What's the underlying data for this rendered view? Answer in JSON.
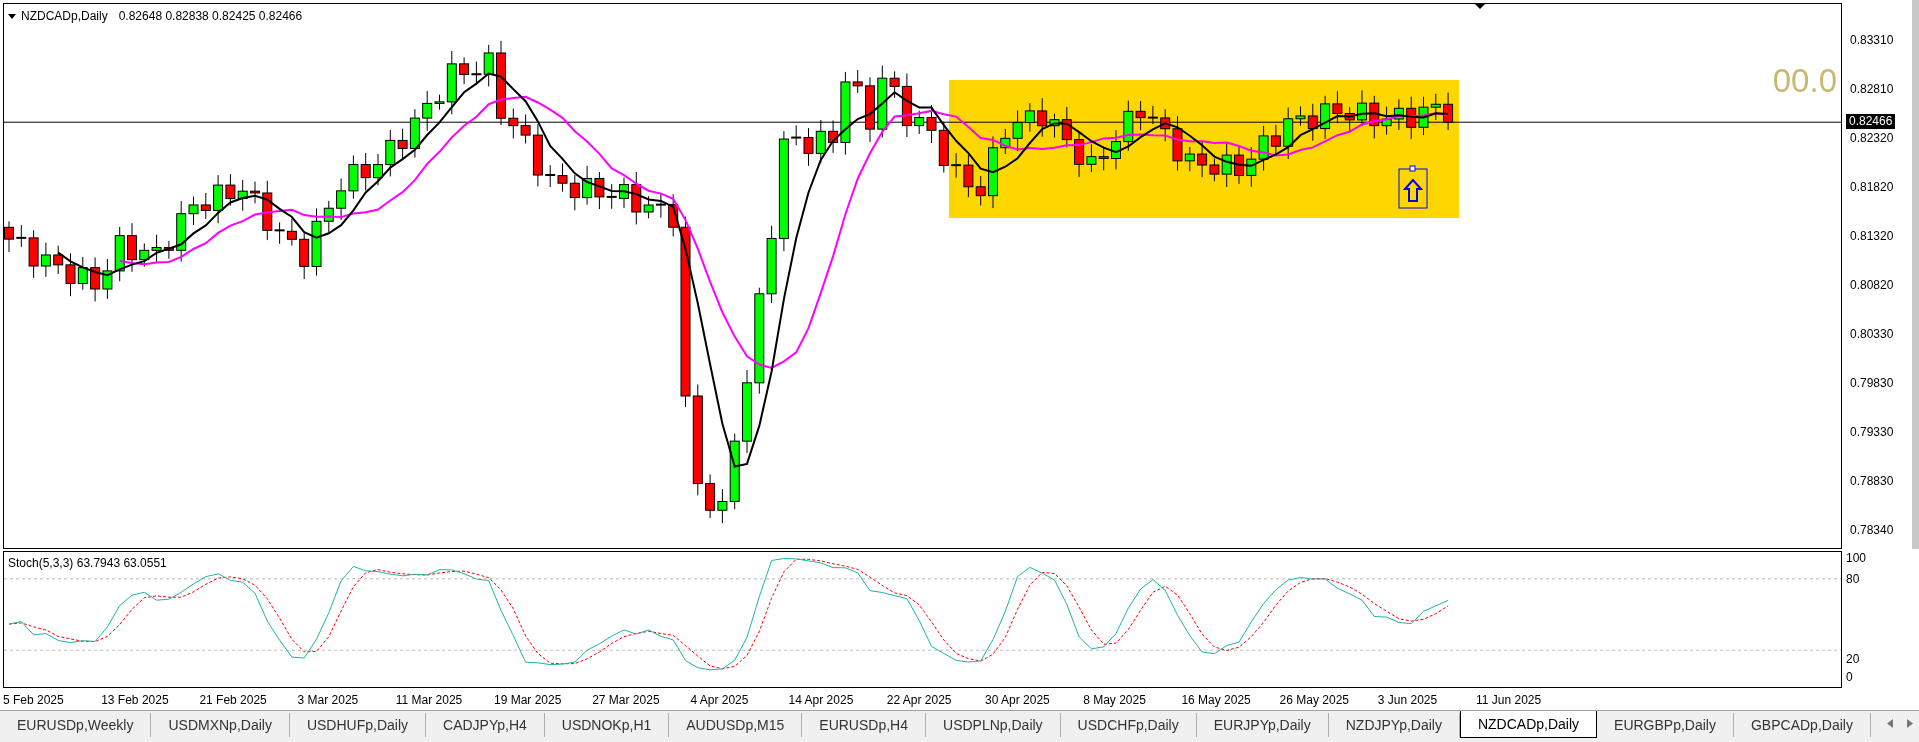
{
  "chart": {
    "title": "NZDCADp,Daily",
    "ohlc": "0.82648 0.82838 0.82425 0.82466",
    "overlay_label": "00.0",
    "current_price": "0.82466",
    "price_ticks": [
      "0.83310",
      "0.82810",
      "0.82320",
      "0.81820",
      "0.81320",
      "0.80820",
      "0.80330",
      "0.79830",
      "0.79330",
      "0.78830",
      "0.78340"
    ]
  },
  "indicator": {
    "title": "Stoch(5,3,3) 63.7943 63.0551",
    "levels": [
      "100",
      "80",
      "20",
      "0"
    ]
  },
  "dates": [
    "5 Feb 2025",
    "13 Feb 2025",
    "21 Feb 2025",
    "3 Mar 2025",
    "11 Mar 2025",
    "19 Mar 2025",
    "27 Mar 2025",
    "4 Apr 2025",
    "14 Apr 2025",
    "22 Apr 2025",
    "30 Apr 2025",
    "8 May 2025",
    "16 May 2025",
    "26 May 2025",
    "3 Jun 2025",
    "11 Jun 2025"
  ],
  "tabs": [
    {
      "label": "EURUSDp,Weekly",
      "selected": false
    },
    {
      "label": "USDMXNp,Daily",
      "selected": false
    },
    {
      "label": "USDHUFp,Daily",
      "selected": false
    },
    {
      "label": "CADJPYp,H4",
      "selected": false
    },
    {
      "label": "USDNOKp,H1",
      "selected": false
    },
    {
      "label": "AUDUSDp,M15",
      "selected": false
    },
    {
      "label": "EURUSDp,H4",
      "selected": false
    },
    {
      "label": "USDPLNp,Daily",
      "selected": false
    },
    {
      "label": "USDCHFp,Daily",
      "selected": false
    },
    {
      "label": "EURJPYp,Daily",
      "selected": false
    },
    {
      "label": "NZDJPYp,Daily",
      "selected": false
    },
    {
      "label": "NZDCADp,Daily",
      "selected": true
    },
    {
      "label": "EURGBPp,Daily",
      "selected": false
    },
    {
      "label": "GBPCADp,Daily",
      "selected": false
    }
  ]
}
